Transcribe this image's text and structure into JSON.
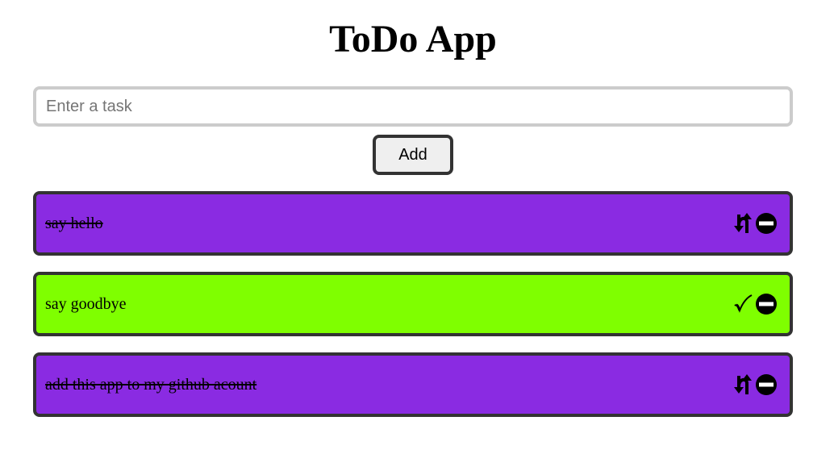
{
  "header": {
    "title": "ToDo App"
  },
  "form": {
    "input_placeholder": "Enter a task",
    "input_value": "",
    "add_label": "Add"
  },
  "colors": {
    "done_background": "#8a2be2",
    "open_background": "#7fff00",
    "border": "#333333",
    "input_border": "#cccccc"
  },
  "tasks": [
    {
      "text": "say hello",
      "completed": true,
      "toggle_icon": "undo-arrows-icon",
      "delete_icon": "remove-circle-icon"
    },
    {
      "text": "say goodbye",
      "completed": false,
      "toggle_icon": "check-mark-icon",
      "delete_icon": "remove-circle-icon"
    },
    {
      "text": "add this app to my github acount",
      "completed": true,
      "toggle_icon": "undo-arrows-icon",
      "delete_icon": "remove-circle-icon"
    }
  ]
}
